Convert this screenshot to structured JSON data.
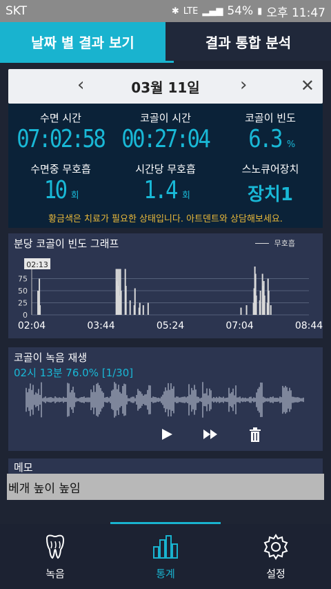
{
  "status_bar": {
    "carrier": "SKT",
    "battery": "54%",
    "time": "오후 11:47",
    "network": "LTE"
  },
  "tabs": [
    {
      "label": "날짜 별 결과 보기",
      "active": true
    },
    {
      "label": "결과 통합 분석",
      "active": false
    }
  ],
  "date_bar": {
    "date": "03월 11일",
    "prev": "‹",
    "next": "›",
    "close": "✕"
  },
  "stats": {
    "sleep_time_label": "수면 시간",
    "sleep_time_value": "07:02:58",
    "snore_time_label": "코골이 시간",
    "snore_time_value": "00:27:04",
    "snore_freq_label": "코골이 빈도",
    "snore_freq_value": "6.3",
    "snore_freq_unit": "%",
    "apnea_label": "수면중 무호흡",
    "apnea_value": "10",
    "apnea_unit": "회",
    "apnea_hour_label": "시간당 무호흡",
    "apnea_hour_value": "1.4",
    "apnea_hour_unit": "회",
    "device_label": "스노큐어장치",
    "device_value": "장치1",
    "notice": "황금색은 치료가 필요한 상태입니다. 아트덴트와 상담해보세요."
  },
  "graph": {
    "title": "분당 코골이 빈도 그래프",
    "legend": "무호흡",
    "tooltip": "02:13"
  },
  "chart_data": {
    "type": "bar",
    "xlabel": "",
    "ylabel": "",
    "ylim": [
      0,
      100
    ],
    "yticks": [
      0,
      25,
      50,
      75
    ],
    "xticks": [
      "02:04",
      "03:44",
      "05:24",
      "07:04",
      "08:44"
    ],
    "x_start_minute": 0,
    "x_end_minute": 400,
    "bars": [
      {
        "minute": 9,
        "value": 50
      },
      {
        "minute": 10,
        "value": 30
      },
      {
        "minute": 11,
        "value": 75
      },
      {
        "minute": 12,
        "value": 20
      },
      {
        "minute": 122,
        "value": 95
      },
      {
        "minute": 123,
        "value": 70
      },
      {
        "minute": 124,
        "value": 95
      },
      {
        "minute": 125,
        "value": 60
      },
      {
        "minute": 126,
        "value": 95
      },
      {
        "minute": 127,
        "value": 40
      },
      {
        "minute": 128,
        "value": 95
      },
      {
        "minute": 129,
        "value": 50
      },
      {
        "minute": 135,
        "value": 95
      },
      {
        "minute": 136,
        "value": 60
      },
      {
        "minute": 142,
        "value": 30
      },
      {
        "minute": 148,
        "value": 20
      },
      {
        "minute": 149,
        "value": 55
      },
      {
        "minute": 155,
        "value": 15
      },
      {
        "minute": 156,
        "value": 25
      },
      {
        "minute": 161,
        "value": 20
      },
      {
        "minute": 168,
        "value": 25
      },
      {
        "minute": 302,
        "value": 15
      },
      {
        "minute": 310,
        "value": 20
      },
      {
        "minute": 320,
        "value": 25
      },
      {
        "minute": 321,
        "value": 55
      },
      {
        "minute": 322,
        "value": 100
      },
      {
        "minute": 323,
        "value": 85
      },
      {
        "minute": 324,
        "value": 40
      },
      {
        "minute": 329,
        "value": 30
      },
      {
        "minute": 330,
        "value": 50
      },
      {
        "minute": 333,
        "value": 85
      },
      {
        "minute": 334,
        "value": 60
      },
      {
        "minute": 335,
        "value": 70
      },
      {
        "minute": 336,
        "value": 40
      },
      {
        "minute": 340,
        "value": 25
      },
      {
        "minute": 341,
        "value": 75
      },
      {
        "minute": 342,
        "value": 50
      },
      {
        "minute": 345,
        "value": 20
      }
    ]
  },
  "audio": {
    "title": "코골이 녹음 재생",
    "subtitle": "02시 13분 76.0% [1/30]",
    "play_icon": "play-icon",
    "fast_forward_icon": "fast-forward-icon",
    "delete_icon": "trash-icon"
  },
  "memo": {
    "title": "메모",
    "text": "베개 높이 높임"
  },
  "bottom_nav": [
    {
      "label": "녹음",
      "icon": "tooth-icon",
      "active": false
    },
    {
      "label": "통계",
      "icon": "bar-chart-icon",
      "active": true
    },
    {
      "label": "설정",
      "icon": "gear-icon",
      "active": false
    }
  ],
  "colors": {
    "accent": "#19b3cf",
    "warning": "#e9b93a",
    "panel": "#2c3550",
    "background": "#1e2433"
  }
}
